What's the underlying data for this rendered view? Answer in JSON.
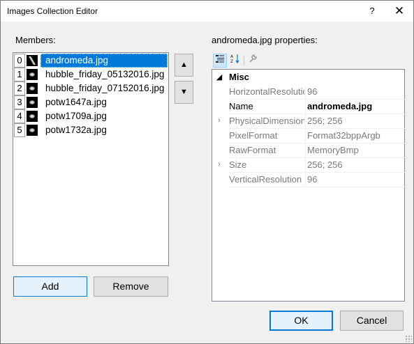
{
  "window": {
    "title": "Images Collection Editor",
    "help_glyph": "?",
    "close_glyph": "✕"
  },
  "members": {
    "label": "Members:",
    "items": [
      {
        "index": "0",
        "name": "andromeda.jpg",
        "selected": true,
        "thumb_icon": "galaxy-streak-thumbnail"
      },
      {
        "index": "1",
        "name": "hubble_friday_05132016.jpg",
        "selected": false,
        "thumb_icon": "galaxy-thumbnail"
      },
      {
        "index": "2",
        "name": "hubble_friday_07152016.jpg",
        "selected": false,
        "thumb_icon": "galaxy-thumbnail"
      },
      {
        "index": "3",
        "name": "potw1647a.jpg",
        "selected": false,
        "thumb_icon": "galaxy-thumbnail"
      },
      {
        "index": "4",
        "name": "potw1709a.jpg",
        "selected": false,
        "thumb_icon": "galaxy-thumbnail"
      },
      {
        "index": "5",
        "name": "potw1732a.jpg",
        "selected": false,
        "thumb_icon": "galaxy-thumbnail"
      }
    ],
    "move_up_glyph": "▲",
    "move_down_glyph": "▼",
    "add_label": "Add",
    "remove_label": "Remove"
  },
  "properties": {
    "label": "andromeda.jpg properties:",
    "toolbar": {
      "categorized_icon": "categorized-icon",
      "alphabetical_icon": "alphabetical-icon",
      "property_pages_icon": "wrench-icon"
    },
    "category": {
      "name": "Misc",
      "expander": "◢"
    },
    "rows": [
      {
        "name": "HorizontalResolution",
        "value": "96",
        "expander": "",
        "editable": false
      },
      {
        "name": "Name",
        "value": "andromeda.jpg",
        "expander": "",
        "editable": true
      },
      {
        "name": "PhysicalDimension",
        "value": "256; 256",
        "expander": "›",
        "editable": false
      },
      {
        "name": "PixelFormat",
        "value": "Format32bppArgb",
        "expander": "",
        "editable": false
      },
      {
        "name": "RawFormat",
        "value": "MemoryBmp",
        "expander": "",
        "editable": false
      },
      {
        "name": "Size",
        "value": "256; 256",
        "expander": "›",
        "editable": false
      },
      {
        "name": "VerticalResolution",
        "value": "96",
        "expander": "",
        "editable": false
      }
    ]
  },
  "footer": {
    "ok_label": "OK",
    "cancel_label": "Cancel"
  },
  "colors": {
    "selection": "#0078d7",
    "default_button_border": "#0078d7",
    "dialog_background": "#f0f0f0"
  }
}
